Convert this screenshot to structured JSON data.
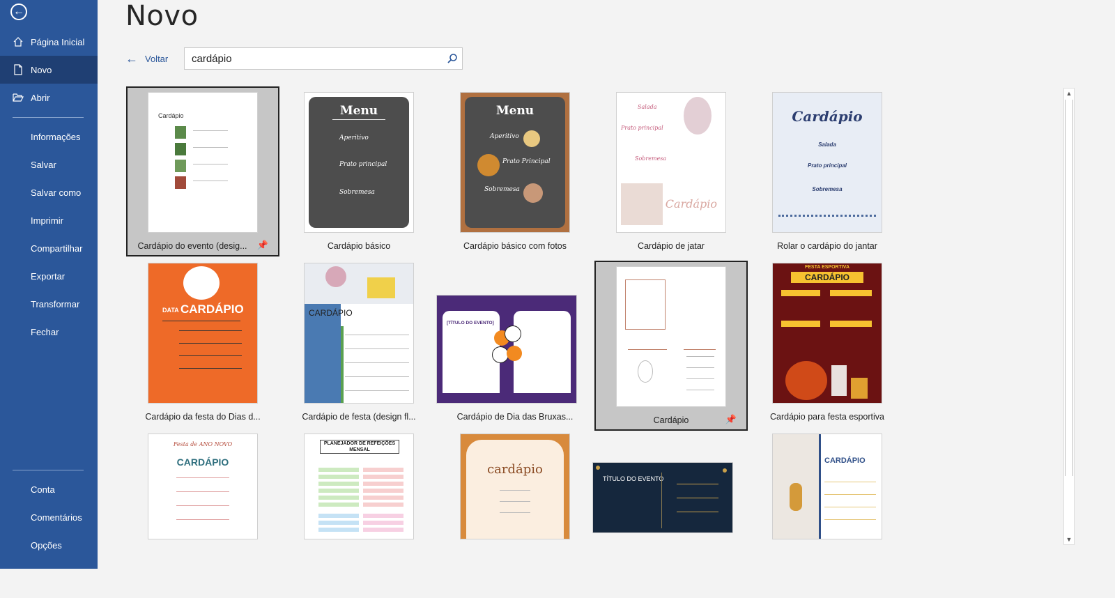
{
  "page": {
    "title": "Novo"
  },
  "nav": {
    "home": "Página Inicial",
    "new": "Novo",
    "open": "Abrir",
    "info": "Informações",
    "save": "Salvar",
    "save_as": "Salvar como",
    "print": "Imprimir",
    "share": "Compartilhar",
    "export": "Exportar",
    "transform": "Transformar",
    "close": "Fechar",
    "account": "Conta",
    "feedback": "Comentários",
    "options": "Opções"
  },
  "back_label": "Voltar",
  "search": {
    "value": "cardápio"
  },
  "templates": [
    {
      "label": "Cardápio do evento (desig...",
      "thumb_title": "Cardápio"
    },
    {
      "label": "Cardápio básico",
      "thumb_title": "Menu",
      "items": [
        "Aperitivo",
        "Prato principal",
        "Sobremesa"
      ]
    },
    {
      "label": "Cardápio básico com fotos",
      "thumb_title": "Menu",
      "items": [
        "Aperitivo",
        "Prato Principal",
        "Sobremesa"
      ]
    },
    {
      "label": "Cardápio de jatar",
      "thumb_title": "Cardápio",
      "items": [
        "Salada",
        "Prato principal",
        "Sobremesa"
      ]
    },
    {
      "label": "Rolar o cardápio do jantar",
      "thumb_title": "Cardápio",
      "items": [
        "Salada",
        "Prato principal",
        "Sobremesa"
      ]
    },
    {
      "label": "Cardápio da festa do Dias d...",
      "thumb_title": "CARDÁPIO",
      "thumb_sub": "DATA"
    },
    {
      "label": "Cardápio de festa (design fl...",
      "thumb_title": "CARDÁPIO"
    },
    {
      "label": "Cardápio de Dia das Bruxas...",
      "thumb_title": "[TÍTULO DO EVENTO]"
    },
    {
      "label": "Cardápio"
    },
    {
      "label": "Cardápio para festa esportiva",
      "thumb_title": "CARDÁPIO",
      "thumb_sub": "FESTA ESPORTIVA"
    },
    {
      "label": "",
      "thumb_title": "CARDÁPIO",
      "thumb_sub": "Festa de ANO NOVO"
    },
    {
      "label": "",
      "thumb_title": "PLANEJADOR DE REFEIÇÕES MENSAL"
    },
    {
      "label": "",
      "thumb_title": "cardápio"
    },
    {
      "label": "",
      "thumb_title": "TÍTULO DO EVENTO"
    },
    {
      "label": "",
      "thumb_title": "CARDÁPIO"
    }
  ],
  "colors": {
    "sidebar": "#2b579a",
    "active": "#1f3f73",
    "accent": "#2b579a"
  }
}
